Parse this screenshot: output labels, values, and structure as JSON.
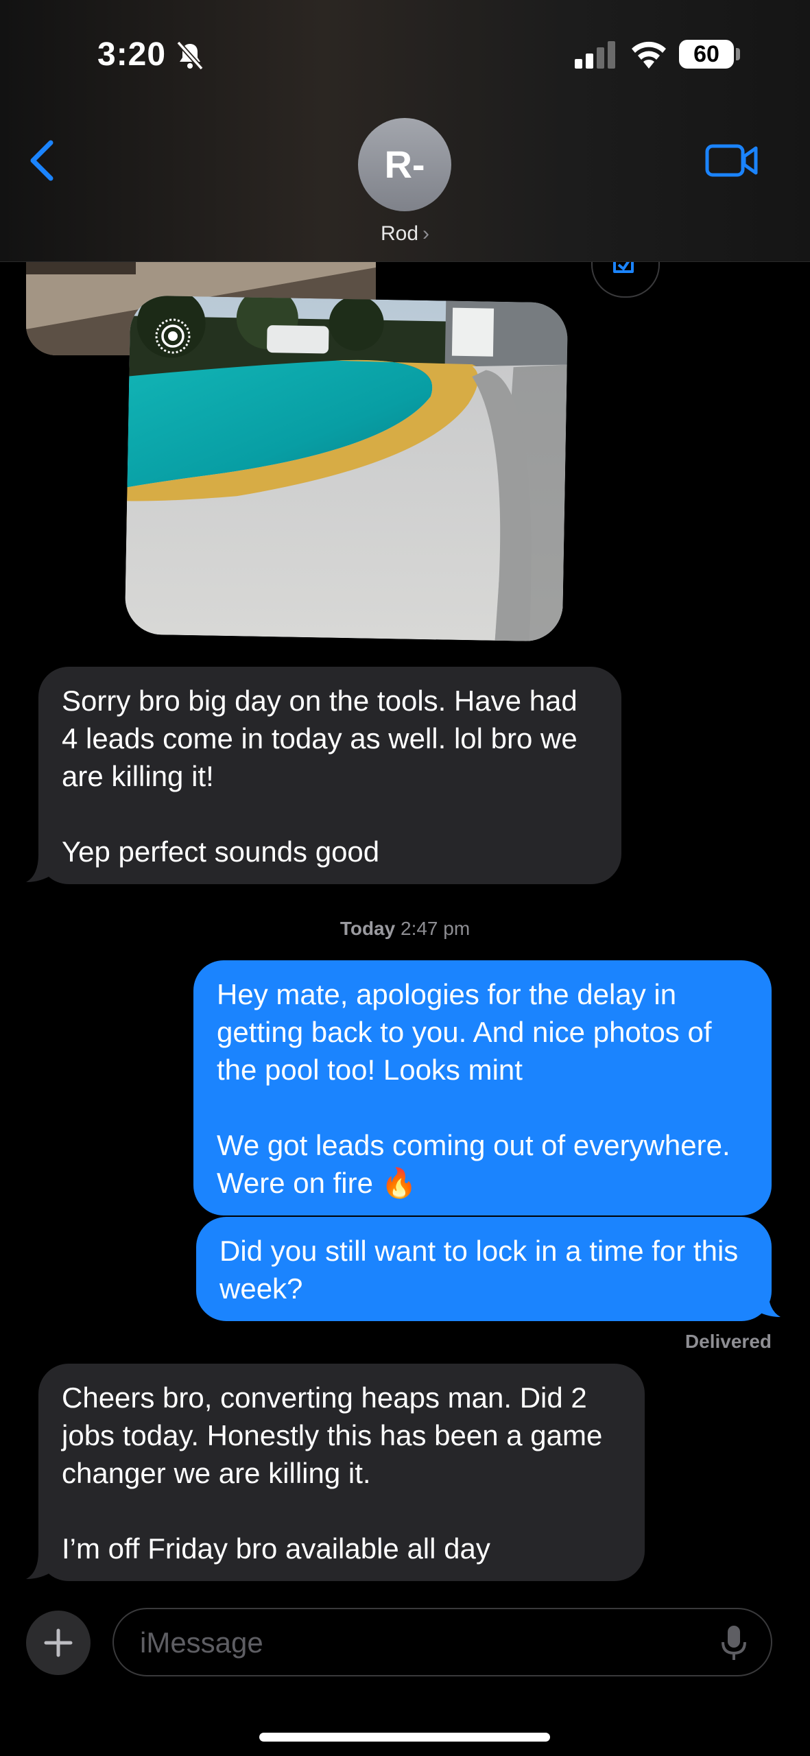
{
  "status_bar": {
    "time": "3:20",
    "battery": "60",
    "icons": [
      "bell-slash-icon",
      "cellular-signal-icon",
      "wifi-icon",
      "battery-icon"
    ]
  },
  "header": {
    "back_icon": "chevron-left-icon",
    "avatar_initials": "R-",
    "contact_name": "Rod",
    "contact_chevron": "›",
    "video_icon": "video-camera-icon",
    "accent_color": "#1b84fe"
  },
  "messages": [
    {
      "direction": "incoming",
      "text": "Sorry bro big day on the tools. Have had 4 leads come in today as well. lol bro we are killing it!\n\nYep perfect sounds good"
    },
    {
      "direction": "outgoing",
      "text": "Hey mate, apologies for the delay in getting back to you. And nice photos of the pool too! Looks mint\n\nWe got leads coming out of everywhere. Were on fire 🔥"
    },
    {
      "direction": "outgoing",
      "text": "Did you still want to lock in a time for this week?"
    },
    {
      "direction": "incoming",
      "text": "Cheers bro, converting heaps man. Did 2 jobs today. Honestly this has been a game changer we are killing it.\n\nI’m off Friday bro available all day"
    }
  ],
  "timestamp": {
    "day": "Today",
    "time": "2:47 pm"
  },
  "delivery_status": "Delivered",
  "compose": {
    "placeholder": "iMessage",
    "plus_icon": "plus-icon",
    "mic_icon": "microphone-icon"
  },
  "colors": {
    "incoming_bubble": "#262629",
    "outgoing_bubble": "#1b84fe",
    "background": "#000000"
  }
}
